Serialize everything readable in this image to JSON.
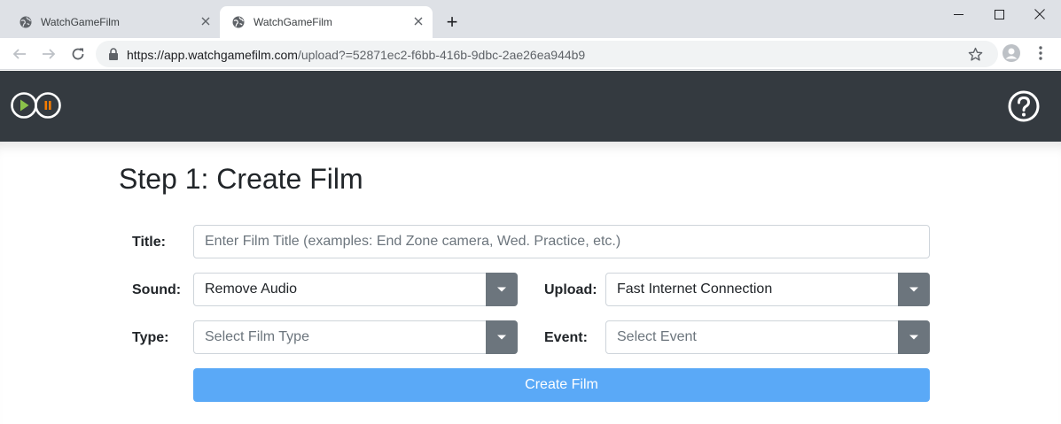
{
  "browser": {
    "tabs": [
      {
        "title": "WatchGameFilm",
        "active": false
      },
      {
        "title": "WatchGameFilm",
        "active": true
      }
    ],
    "new_tab_symbol": "+",
    "url_host": "https://app.watchgamefilm.com",
    "url_path": "/upload?=52871ec2-f6bb-416b-9dbc-2ae26ea944b9"
  },
  "header": {
    "logo_icon": "play-pause-logo-icon",
    "help_icon": "help-question-icon"
  },
  "form": {
    "title": "Step 1: Create Film",
    "title_label": "Title:",
    "title_placeholder": "Enter Film Title (examples: End Zone camera, Wed. Practice, etc.)",
    "sound_label": "Sound:",
    "sound_value": "Remove Audio",
    "upload_label": "Upload:",
    "upload_value": "Fast Internet Connection",
    "type_label": "Type:",
    "type_placeholder": "Select Film Type",
    "event_label": "Event:",
    "event_placeholder": "Select Event",
    "submit_label": "Create Film"
  },
  "colors": {
    "header_bg": "#343a40",
    "submit_bg": "#5aa9f7",
    "select_button_bg": "#6c757d",
    "logo_play": "#8bc34a",
    "logo_pause": "#f57c00"
  }
}
